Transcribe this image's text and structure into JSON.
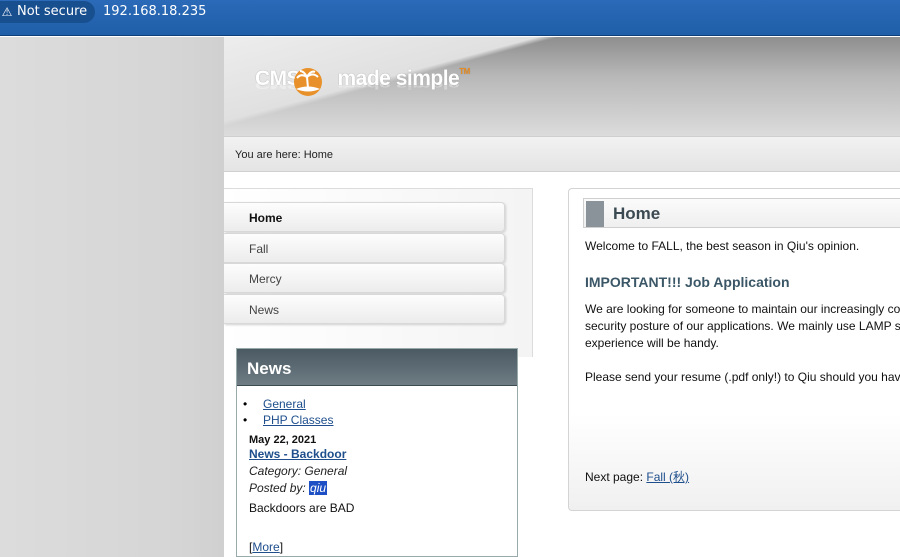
{
  "browser": {
    "security_label": "Not secure",
    "warning_icon": "warning-icon",
    "url": "192.168.18.235"
  },
  "header": {
    "logo_text": "CMS made simple",
    "logo_tm": "TM"
  },
  "breadcrumb": {
    "text": "You are here: Home"
  },
  "menu": {
    "items": [
      {
        "label": "Home",
        "active": true
      },
      {
        "label": "Fall",
        "active": false
      },
      {
        "label": "Mercy",
        "active": false
      },
      {
        "label": "News",
        "active": false
      }
    ]
  },
  "news": {
    "title": "News",
    "categories": [
      "General",
      "PHP Classes"
    ],
    "date": "May 22, 2021",
    "item_title": "News - Backdoor",
    "category_line": "Category: General",
    "posted_prefix": "Posted by: ",
    "author": "qiu",
    "summary": "Backdoors are BAD",
    "more_open": "[",
    "more_label": "More",
    "more_close": "]"
  },
  "content": {
    "title": "Home",
    "welcome": "Welcome to FALL, the best season in Qiu's opinion.",
    "important_heading": "IMPORTANT!!! Job Application",
    "para1_line1": "We are looking for someone to maintain our increasingly co",
    "para1_line2": "security posture of our applications. We mainly use LAMP s",
    "para1_line3": "experience will be handy.",
    "para2": "Please send your resume (.pdf only!) to Qiu should you hav",
    "next_prefix": "Next page: ",
    "next_link": "Fall (秋)"
  },
  "colors": {
    "address_bar": "#2b6ab8",
    "heading": "#3b5767",
    "link": "#1e4e8c",
    "news_header": "#4a5a63"
  }
}
